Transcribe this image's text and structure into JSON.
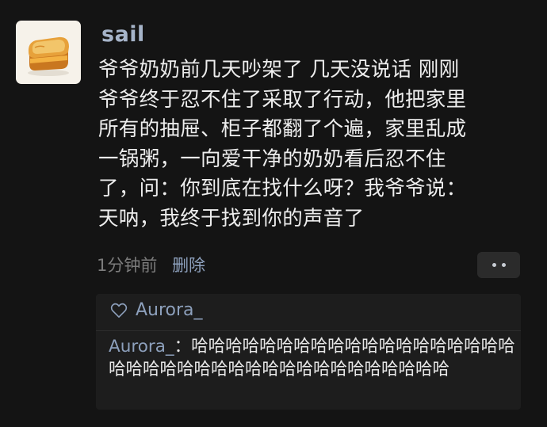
{
  "post": {
    "username": "sail",
    "body": "爷爷奶奶前几天吵架了 几天没说话 刚刚\n爷爷终于忍不住了采取了行动，他把家里\n所有的抽屉、柜子都翻了个遍，家里乱成\n一锅粥，一向爱干净的奶奶看后忍不住\n了，问：你到底在找什么呀？我爷爷说：\n天呐，我终于找到你的声音了",
    "time": "1分钟前",
    "delete_label": "删除"
  },
  "comments": {
    "liker": "Aurora_",
    "items": [
      {
        "author": "Aurora_",
        "separator": "：",
        "text": "哈哈哈哈哈哈哈哈哈哈哈哈哈哈哈哈哈哈哈哈哈哈哈哈哈哈哈哈哈哈哈哈哈哈哈哈哈哈哈"
      }
    ]
  },
  "colors": {
    "background": "#141414",
    "name_accent": "#8da0bc",
    "body_text": "#ededed",
    "muted": "#7c7c7c"
  },
  "icons": {
    "avatar": "toast-image",
    "like": "heart-outline-icon",
    "more": "more-dots-icon"
  }
}
